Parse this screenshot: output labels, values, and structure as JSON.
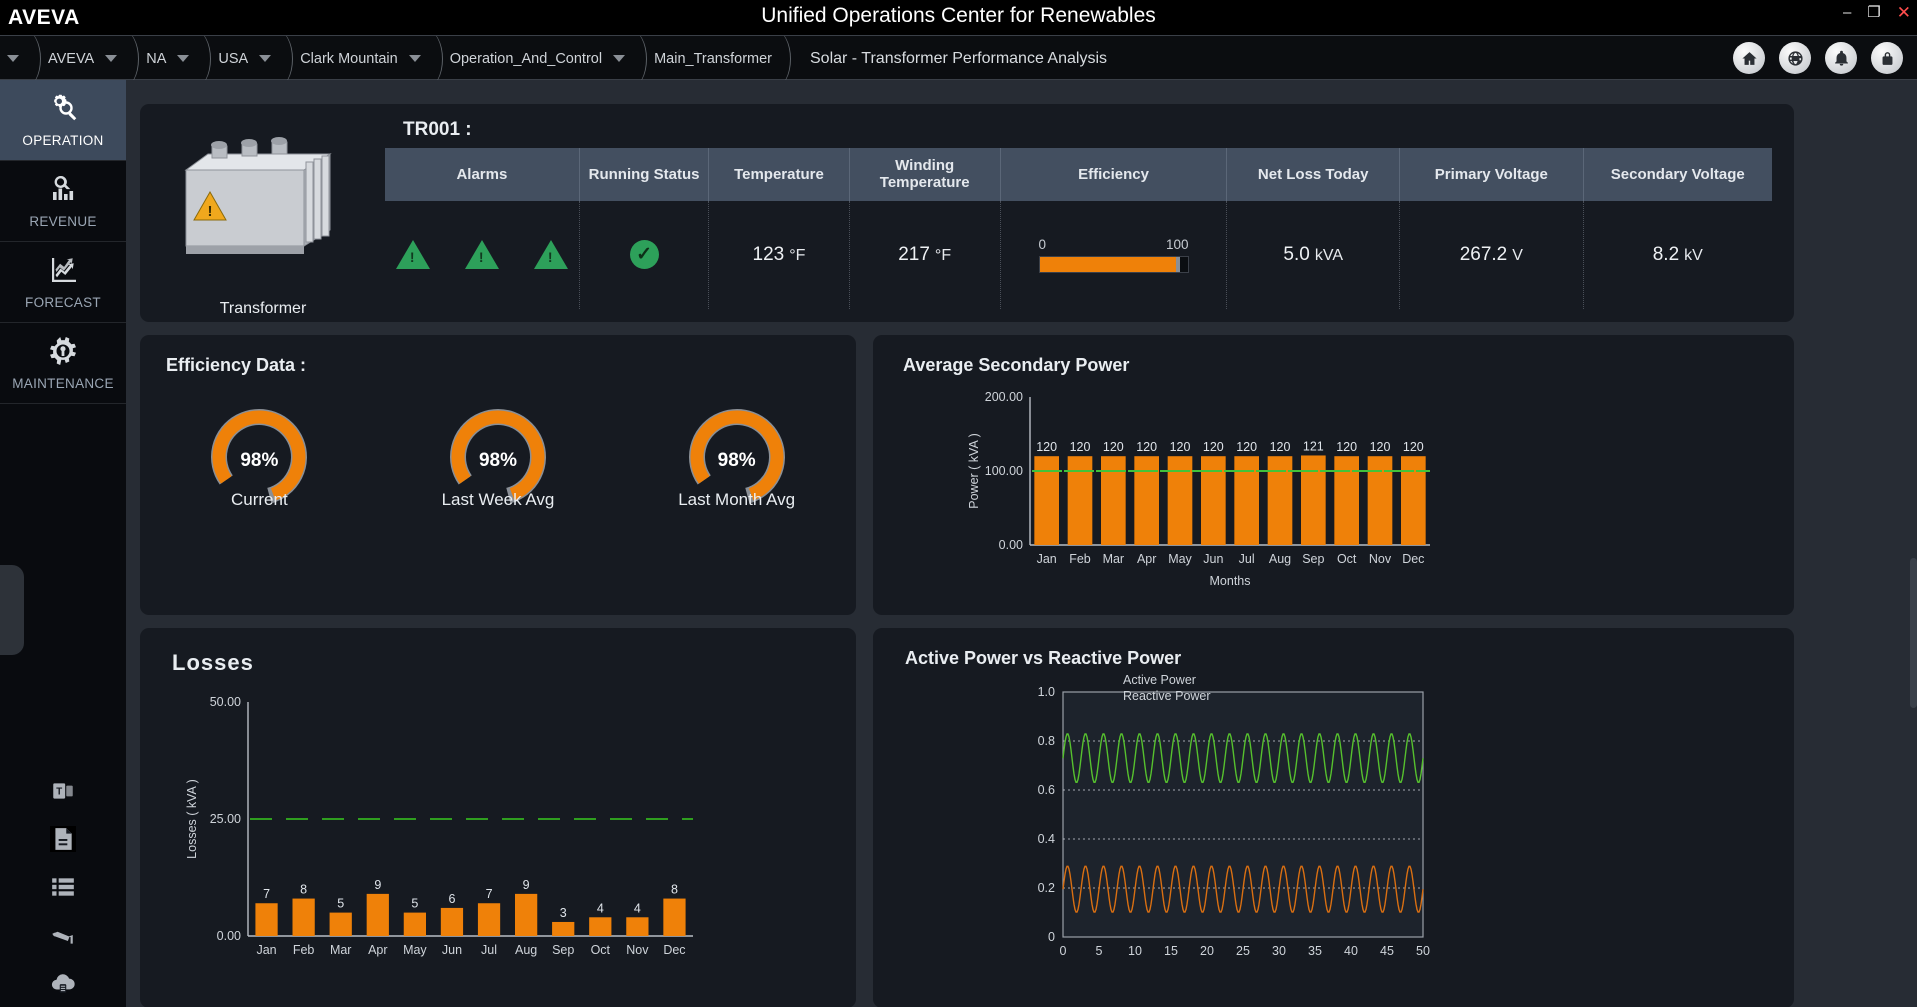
{
  "window": {
    "app_title": "Unified Operations Center for Renewables",
    "logo_text": "AVEVA",
    "minimize_label": "–",
    "maximize_label": "❐",
    "close_label": "✕"
  },
  "breadcrumb": {
    "items": [
      {
        "label": "AVEVA"
      },
      {
        "label": "NA"
      },
      {
        "label": "USA"
      },
      {
        "label": "Clark Mountain"
      },
      {
        "label": "Operation_And_Control"
      },
      {
        "label": "Main_Transformer"
      }
    ],
    "subtitle": "Solar - Transformer Performance Analysis",
    "icons": [
      "home-icon",
      "globe-icon",
      "bell-icon",
      "lock-icon"
    ]
  },
  "sidebar": {
    "items": [
      {
        "label": "OPERATION",
        "icon": "gear-magnifier-icon",
        "active": true
      },
      {
        "label": "REVENUE",
        "icon": "magnifier-bars-icon",
        "active": false
      },
      {
        "label": "FORECAST",
        "icon": "trend-chart-icon",
        "active": false
      },
      {
        "label": "MAINTENANCE",
        "icon": "gear-wrench-icon",
        "active": false
      }
    ],
    "bottom_icons": [
      "teams-icon",
      "document-icon",
      "list-icon",
      "camera-icon",
      "cloud-database-icon"
    ]
  },
  "tr001": {
    "title": "TR001 :",
    "device_caption": "Transformer",
    "columns": [
      "Alarms",
      "Running Status",
      "Temperature",
      "Winding Temperature",
      "Efficiency",
      "Net Loss Today",
      "Primary Voltage",
      "Secondary Voltage"
    ],
    "alarm_count": 3,
    "alarm_color": "#2da05a",
    "running_status": "ok",
    "temperature": {
      "value": "123",
      "unit": "°F"
    },
    "winding_temperature": {
      "value": "217",
      "unit": "°F"
    },
    "efficiency_bar": {
      "min": "0",
      "max": "100",
      "percent": 92,
      "color": "#ef8109"
    },
    "net_loss_today": {
      "value": "5.0",
      "unit": "kVA"
    },
    "primary_voltage": {
      "value": "267.2",
      "unit": "V"
    },
    "secondary_voltage": {
      "value": "8.2",
      "unit": "kV"
    }
  },
  "efficiency_card": {
    "title": "Efficiency Data :",
    "gauges": [
      {
        "value": "98%",
        "caption": "Current",
        "percent": 98
      },
      {
        "value": "98%",
        "caption": "Last Week Avg",
        "percent": 98
      },
      {
        "value": "98%",
        "caption": "Last Month Avg",
        "percent": 98
      }
    ],
    "arc_color": "#ef8109",
    "track_color": "#8a8f96"
  },
  "chart_data": [
    {
      "id": "average_secondary_power",
      "type": "bar",
      "title": "Average Secondary Power",
      "xlabel": "Months",
      "ylabel": "Power ( kVA )",
      "categories": [
        "Jan",
        "Feb",
        "Mar",
        "Apr",
        "May",
        "Jun",
        "Jul",
        "Aug",
        "Sep",
        "Oct",
        "Nov",
        "Dec"
      ],
      "values": [
        120,
        120,
        120,
        120,
        120,
        120,
        120,
        120,
        121,
        120,
        120,
        120
      ],
      "ylim": [
        0,
        200
      ],
      "yticks": [
        "0.00",
        "100.00",
        "200.00"
      ],
      "bar_color": "#ef8109",
      "threshold": {
        "value": 100,
        "color": "#41c23a"
      },
      "grid": false,
      "legend": "none"
    },
    {
      "id": "losses",
      "type": "bar",
      "title": "Losses",
      "xlabel": "",
      "ylabel": "Losses ( kVA )",
      "categories": [
        "Jan",
        "Feb",
        "Mar",
        "Apr",
        "May",
        "Jun",
        "Jul",
        "Aug",
        "Sep",
        "Oct",
        "Nov",
        "Dec"
      ],
      "values": [
        7,
        8,
        5,
        9,
        5,
        6,
        7,
        9,
        3,
        4,
        4,
        8
      ],
      "ylim": [
        0,
        50
      ],
      "yticks": [
        "0.00",
        "25.00",
        "50.00"
      ],
      "bar_color": "#ef8109",
      "threshold": {
        "value": 25,
        "color": "#2f9e1f"
      },
      "grid": false,
      "legend": "none"
    },
    {
      "id": "active_vs_reactive_power",
      "type": "line",
      "title": "Active Power vs Reactive Power",
      "xlabel": "",
      "ylabel": "",
      "xlim": [
        0,
        50
      ],
      "xticks": [
        "0",
        "5",
        "10",
        "15",
        "20",
        "25",
        "30",
        "35",
        "40",
        "45",
        "50"
      ],
      "ylim": [
        0,
        1.0
      ],
      "yticks": [
        "0",
        "0.2",
        "0.4",
        "0.6",
        "0.8",
        "1.0"
      ],
      "grid": true,
      "legend_position": "top-right",
      "series": [
        {
          "name": "Active Power",
          "color": "#56c12e",
          "mean": 0.73,
          "amplitude": 0.1,
          "period": 2.5
        },
        {
          "name": "Reactive Power",
          "color": "#d96f12",
          "mean": 0.195,
          "amplitude": 0.095,
          "period": 2.5
        }
      ]
    }
  ]
}
